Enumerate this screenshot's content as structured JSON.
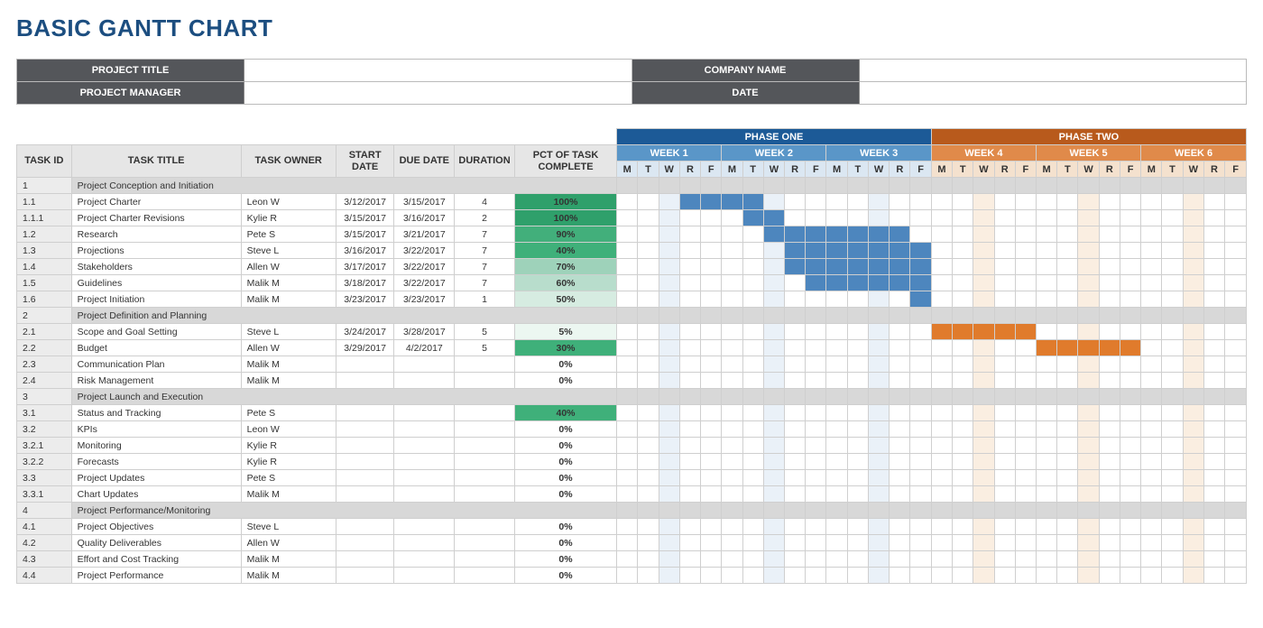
{
  "title": "BASIC GANTT CHART",
  "info": {
    "projectTitleLabel": "PROJECT TITLE",
    "projectTitleValue": "",
    "projectManagerLabel": "PROJECT MANAGER",
    "projectManagerValue": "",
    "companyLabel": "COMPANY NAME",
    "companyValue": "",
    "dateLabel": "DATE",
    "dateValue": ""
  },
  "columns": {
    "id": "TASK ID",
    "title": "TASK TITLE",
    "owner": "TASK OWNER",
    "start": "START DATE",
    "due": "DUE DATE",
    "dur": "DURATION",
    "pct": "PCT OF TASK COMPLETE"
  },
  "phases": {
    "one": "PHASE ONE",
    "two": "PHASE TWO"
  },
  "weeks": [
    "WEEK 1",
    "WEEK 2",
    "WEEK 3",
    "WEEK 4",
    "WEEK 5",
    "WEEK 6"
  ],
  "days": [
    "M",
    "T",
    "W",
    "R",
    "F"
  ],
  "chart_data": {
    "type": "gantt",
    "title": "BASIC GANTT CHART",
    "phases": [
      {
        "name": "PHASE ONE",
        "weeks": [
          "WEEK 1",
          "WEEK 2",
          "WEEK 3"
        ],
        "color": "#1c5a97"
      },
      {
        "name": "PHASE TWO",
        "weeks": [
          "WEEK 4",
          "WEEK 5",
          "WEEK 6"
        ],
        "color": "#b85a1c"
      }
    ],
    "days_per_week": [
      "M",
      "T",
      "W",
      "R",
      "F"
    ],
    "tasks": [
      {
        "id": "1",
        "title": "Project Conception and Initiation",
        "section": true
      },
      {
        "id": "1.1",
        "title": "Project Charter",
        "owner": "Leon W",
        "start": "3/12/2017",
        "due": "3/15/2017",
        "duration": 4,
        "pct": 100,
        "bar_start_day": 4,
        "bar_len": 4,
        "bar_color": "blue"
      },
      {
        "id": "1.1.1",
        "title": "Project Charter Revisions",
        "owner": "Kylie R",
        "start": "3/15/2017",
        "due": "3/16/2017",
        "duration": 2,
        "pct": 100,
        "bar_start_day": 7,
        "bar_len": 2,
        "bar_color": "blue"
      },
      {
        "id": "1.2",
        "title": "Research",
        "owner": "Pete S",
        "start": "3/15/2017",
        "due": "3/21/2017",
        "duration": 7,
        "pct": 90,
        "bar_start_day": 8,
        "bar_len": 7,
        "bar_color": "blue"
      },
      {
        "id": "1.3",
        "title": "Projections",
        "owner": "Steve L",
        "start": "3/16/2017",
        "due": "3/22/2017",
        "duration": 7,
        "pct": 40,
        "bar_start_day": 9,
        "bar_len": 7,
        "bar_color": "blue"
      },
      {
        "id": "1.4",
        "title": "Stakeholders",
        "owner": "Allen W",
        "start": "3/17/2017",
        "due": "3/22/2017",
        "duration": 7,
        "pct": 70,
        "bar_start_day": 9,
        "bar_len": 7,
        "bar_color": "blue"
      },
      {
        "id": "1.5",
        "title": "Guidelines",
        "owner": "Malik M",
        "start": "3/18/2017",
        "due": "3/22/2017",
        "duration": 7,
        "pct": 60,
        "bar_start_day": 10,
        "bar_len": 6,
        "bar_color": "blue"
      },
      {
        "id": "1.6",
        "title": "Project Initiation",
        "owner": "Malik M",
        "start": "3/23/2017",
        "due": "3/23/2017",
        "duration": 1,
        "pct": 50,
        "bar_start_day": 15,
        "bar_len": 1,
        "bar_color": "blue"
      },
      {
        "id": "2",
        "title": "Project Definition and Planning",
        "section": true
      },
      {
        "id": "2.1",
        "title": "Scope and Goal Setting",
        "owner": "Steve L",
        "start": "3/24/2017",
        "due": "3/28/2017",
        "duration": 5,
        "pct": 5,
        "bar_start_day": 16,
        "bar_len": 5,
        "bar_color": "orange"
      },
      {
        "id": "2.2",
        "title": "Budget",
        "owner": "Allen W",
        "start": "3/29/2017",
        "due": "4/2/2017",
        "duration": 5,
        "pct": 30,
        "bar_start_day": 21,
        "bar_len": 5,
        "bar_color": "orange"
      },
      {
        "id": "2.3",
        "title": "Communication Plan",
        "owner": "Malik M",
        "pct": 0
      },
      {
        "id": "2.4",
        "title": "Risk Management",
        "owner": "Malik M",
        "pct": 0
      },
      {
        "id": "3",
        "title": "Project Launch and Execution",
        "section": true
      },
      {
        "id": "3.1",
        "title": "Status and Tracking",
        "owner": "Pete S",
        "pct": 40,
        "pct_green": true
      },
      {
        "id": "3.2",
        "title": "KPIs",
        "owner": "Leon W",
        "pct": 0
      },
      {
        "id": "3.2.1",
        "title": "Monitoring",
        "owner": "Kylie R",
        "pct": 0
      },
      {
        "id": "3.2.2",
        "title": "Forecasts",
        "owner": "Kylie R",
        "pct": 0
      },
      {
        "id": "3.3",
        "title": "Project Updates",
        "owner": "Pete S",
        "pct": 0
      },
      {
        "id": "3.3.1",
        "title": "Chart Updates",
        "owner": "Malik M",
        "pct": 0
      },
      {
        "id": "4",
        "title": "Project Performance/Monitoring",
        "section": true
      },
      {
        "id": "4.1",
        "title": "Project Objectives",
        "owner": "Steve L",
        "pct": 0
      },
      {
        "id": "4.2",
        "title": "Quality Deliverables",
        "owner": "Allen W",
        "pct": 0
      },
      {
        "id": "4.3",
        "title": "Effort and Cost Tracking",
        "owner": "Malik M",
        "pct": 0
      },
      {
        "id": "4.4",
        "title": "Project Performance",
        "owner": "Malik M",
        "pct": 0
      }
    ]
  }
}
